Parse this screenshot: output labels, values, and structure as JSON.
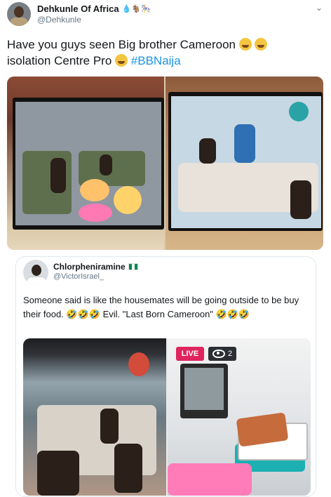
{
  "tweet": {
    "display_name": "Dehkunle Of Africa",
    "handle": "@Dehkunle",
    "name_emojis": "💧🐐🎠",
    "text_line1": "Have you guys seen Big brother Cameroon",
    "text_line2": "isolation Centre Pro",
    "hashtag": "#BBNaija",
    "chevron": "⌄"
  },
  "quote": {
    "display_name": "Chlorpheniramine",
    "handle": "@VictorIsrael_",
    "text": "Someone said is like the housemates will be going outside to be buy their food. 🤣🤣🤣 Evil. \"Last Born Cameroon\" 🤣🤣🤣",
    "live_label": "LIVE",
    "viewers": "2"
  },
  "colors": {
    "hashtag": "#1b95e0",
    "live": "#e0245e",
    "handle": "#657786"
  },
  "icons": [
    "chevron-down-icon",
    "eye-icon",
    "flag-icon"
  ]
}
